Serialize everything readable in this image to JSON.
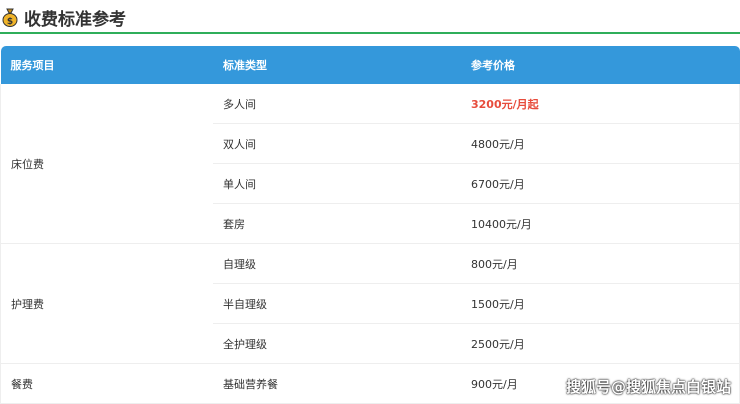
{
  "title": "收费标准参考",
  "headers": [
    "服务项目",
    "标准类型",
    "参考价格"
  ],
  "groups": [
    {
      "name": "床位费",
      "rows": [
        [
          "多人间",
          "3200元/月起"
        ],
        [
          "双人间",
          "4800元/月"
        ],
        [
          "单人间",
          "6700元/月"
        ],
        [
          "套房",
          "10400元/月"
        ]
      ]
    },
    {
      "name": "护理费",
      "rows": [
        [
          "自理级",
          "800元/月"
        ],
        [
          "半自理级",
          "1500元/月"
        ],
        [
          "全护理级",
          "2500元/月"
        ]
      ]
    },
    {
      "name": "餐费",
      "rows": [
        [
          "基础营养餐",
          "900元/月"
        ]
      ]
    }
  ],
  "watermark": "搜狐号@搜狐焦点白银站",
  "colors": {
    "header": "#3498db",
    "accent_line": "#2fae5a",
    "highlight": "#e74c3c"
  }
}
